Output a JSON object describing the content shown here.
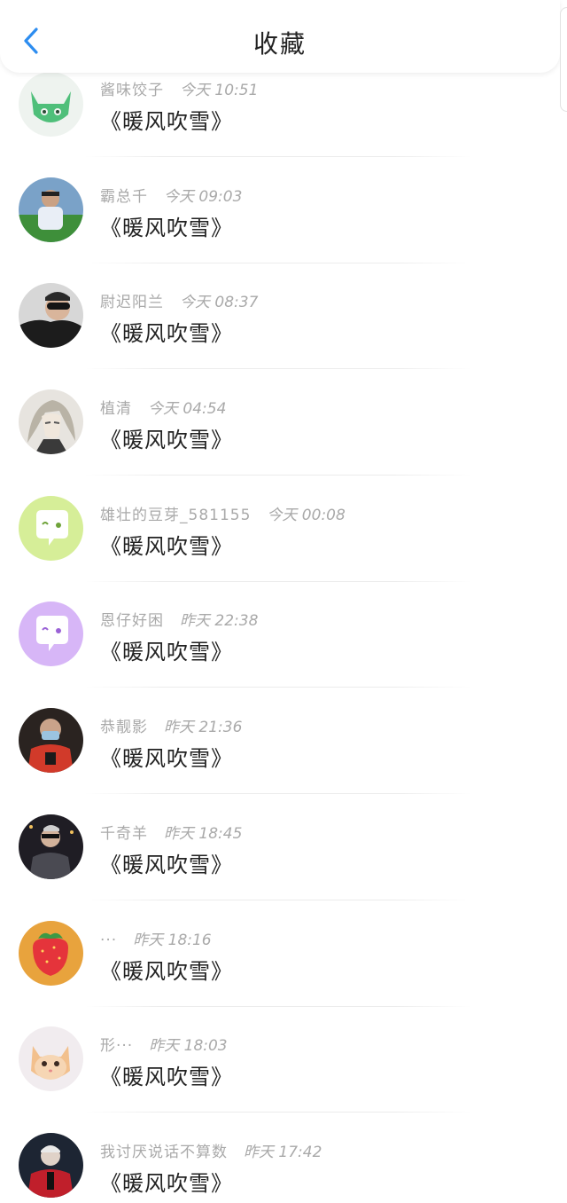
{
  "header": {
    "title": "收藏",
    "back_icon": "chevron-left-icon",
    "accent": "#2d8df0"
  },
  "favorites": [
    {
      "user": "酱味饺子",
      "time": "今天 10:51",
      "title": "《暖风吹雪》",
      "avatar": "cat-green"
    },
    {
      "user": "霸总千",
      "time": "今天 09:03",
      "title": "《暖风吹雪》",
      "avatar": "photo-boy-field"
    },
    {
      "user": "尉迟阳兰",
      "time": "今天 08:37",
      "title": "《暖风吹雪》",
      "avatar": "photo-sunglasses"
    },
    {
      "user": "植清",
      "time": "今天 04:54",
      "title": "《暖风吹雪》",
      "avatar": "anime-silver-hair"
    },
    {
      "user": "雄壮的豆芽_581155",
      "time": "今天 00:08",
      "title": "《暖风吹雪》",
      "avatar": "chat-bubble-green"
    },
    {
      "user": "恩仔好困",
      "time": "昨天 22:38",
      "title": "《暖风吹雪》",
      "avatar": "chat-bubble-purple"
    },
    {
      "user": "恭靓影",
      "time": "昨天 21:36",
      "title": "《暖风吹雪》",
      "avatar": "photo-red-mask"
    },
    {
      "user": "千奇羊",
      "time": "昨天 18:45",
      "title": "《暖风吹雪》",
      "avatar": "photo-night-boy"
    },
    {
      "user": "···",
      "time": "昨天 18:16",
      "title": "《暖风吹雪》",
      "avatar": "strawberry"
    },
    {
      "user": "形···",
      "time": "昨天 18:03",
      "title": "《暖风吹雪》",
      "avatar": "kitten"
    },
    {
      "user": "我讨厌说话不算数",
      "time": "昨天 17:42",
      "title": "《暖风吹雪》",
      "avatar": "photo-red-jacket"
    }
  ]
}
